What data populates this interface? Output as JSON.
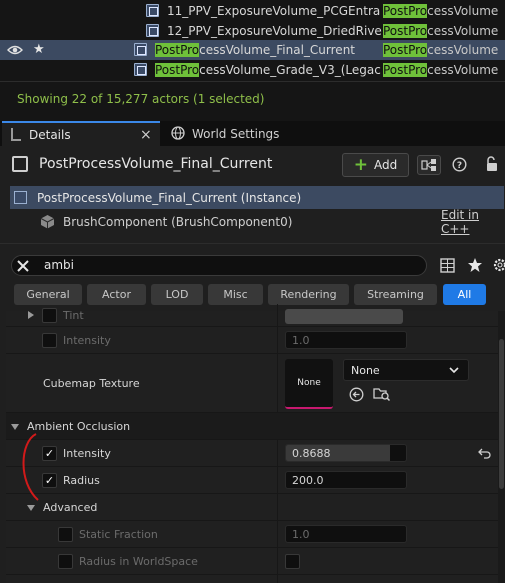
{
  "outliner": {
    "rows": [
      {
        "name": "11_PPV_ExposureVolume_PCGEntra",
        "type_highlight": "PostPro",
        "type_rest": "cessVolume"
      },
      {
        "name": "12_PPV_ExposureVolume_DriedRive",
        "type_highlight": "PostPro",
        "type_rest": "cessVolume"
      },
      {
        "name_highlight": "PostPro",
        "name_rest": "cessVolume_Final_Current",
        "type_highlight": "PostPro",
        "type_rest": "cessVolume",
        "selected": true
      },
      {
        "name_highlight": "PostPro",
        "name_rest": "cessVolume_Grade_V3_(Legac",
        "type_highlight": "PostPro",
        "type_rest": "cessVolume"
      }
    ],
    "selected_star": "★",
    "status": "Showing 22 of 15,277 actors (1 selected)"
  },
  "tabs": {
    "details": "Details",
    "details_close": "×",
    "world_settings": "World Settings"
  },
  "details": {
    "actor_title": "PostProcessVolume_Final_Current",
    "add_label": "Add",
    "instance_label": "PostProcessVolume_Final_Current (Instance)",
    "component_label": "BrushComponent (BrushComponent0)",
    "edit_link": "Edit in C++"
  },
  "search": {
    "value": "ambi"
  },
  "filters": [
    "General",
    "Actor",
    "LOD",
    "Misc",
    "Rendering",
    "Streaming",
    "All"
  ],
  "props": {
    "tint_label": "Tint",
    "intensity_top_label": "Intensity",
    "intensity_top_value": "1.0",
    "cubemap_label": "Cubemap Texture",
    "cubemap_thumb": "None",
    "cubemap_select": "None",
    "ao_section": "Ambient Occlusion",
    "ao_intensity_label": "Intensity",
    "ao_intensity_value": "0.8688",
    "ao_intensity_fraction": 0.8688,
    "ao_radius_label": "Radius",
    "ao_radius_value": "200.0",
    "advanced_label": "Advanced",
    "static_fraction_label": "Static Fraction",
    "static_fraction_value": "1.0",
    "radius_ws_label": "Radius in WorldSpace"
  },
  "colors": {
    "accent": "#1f7ae6",
    "highlight": "#6fc13a",
    "selection": "#3c4a61",
    "annotation": "#d11a1a"
  }
}
